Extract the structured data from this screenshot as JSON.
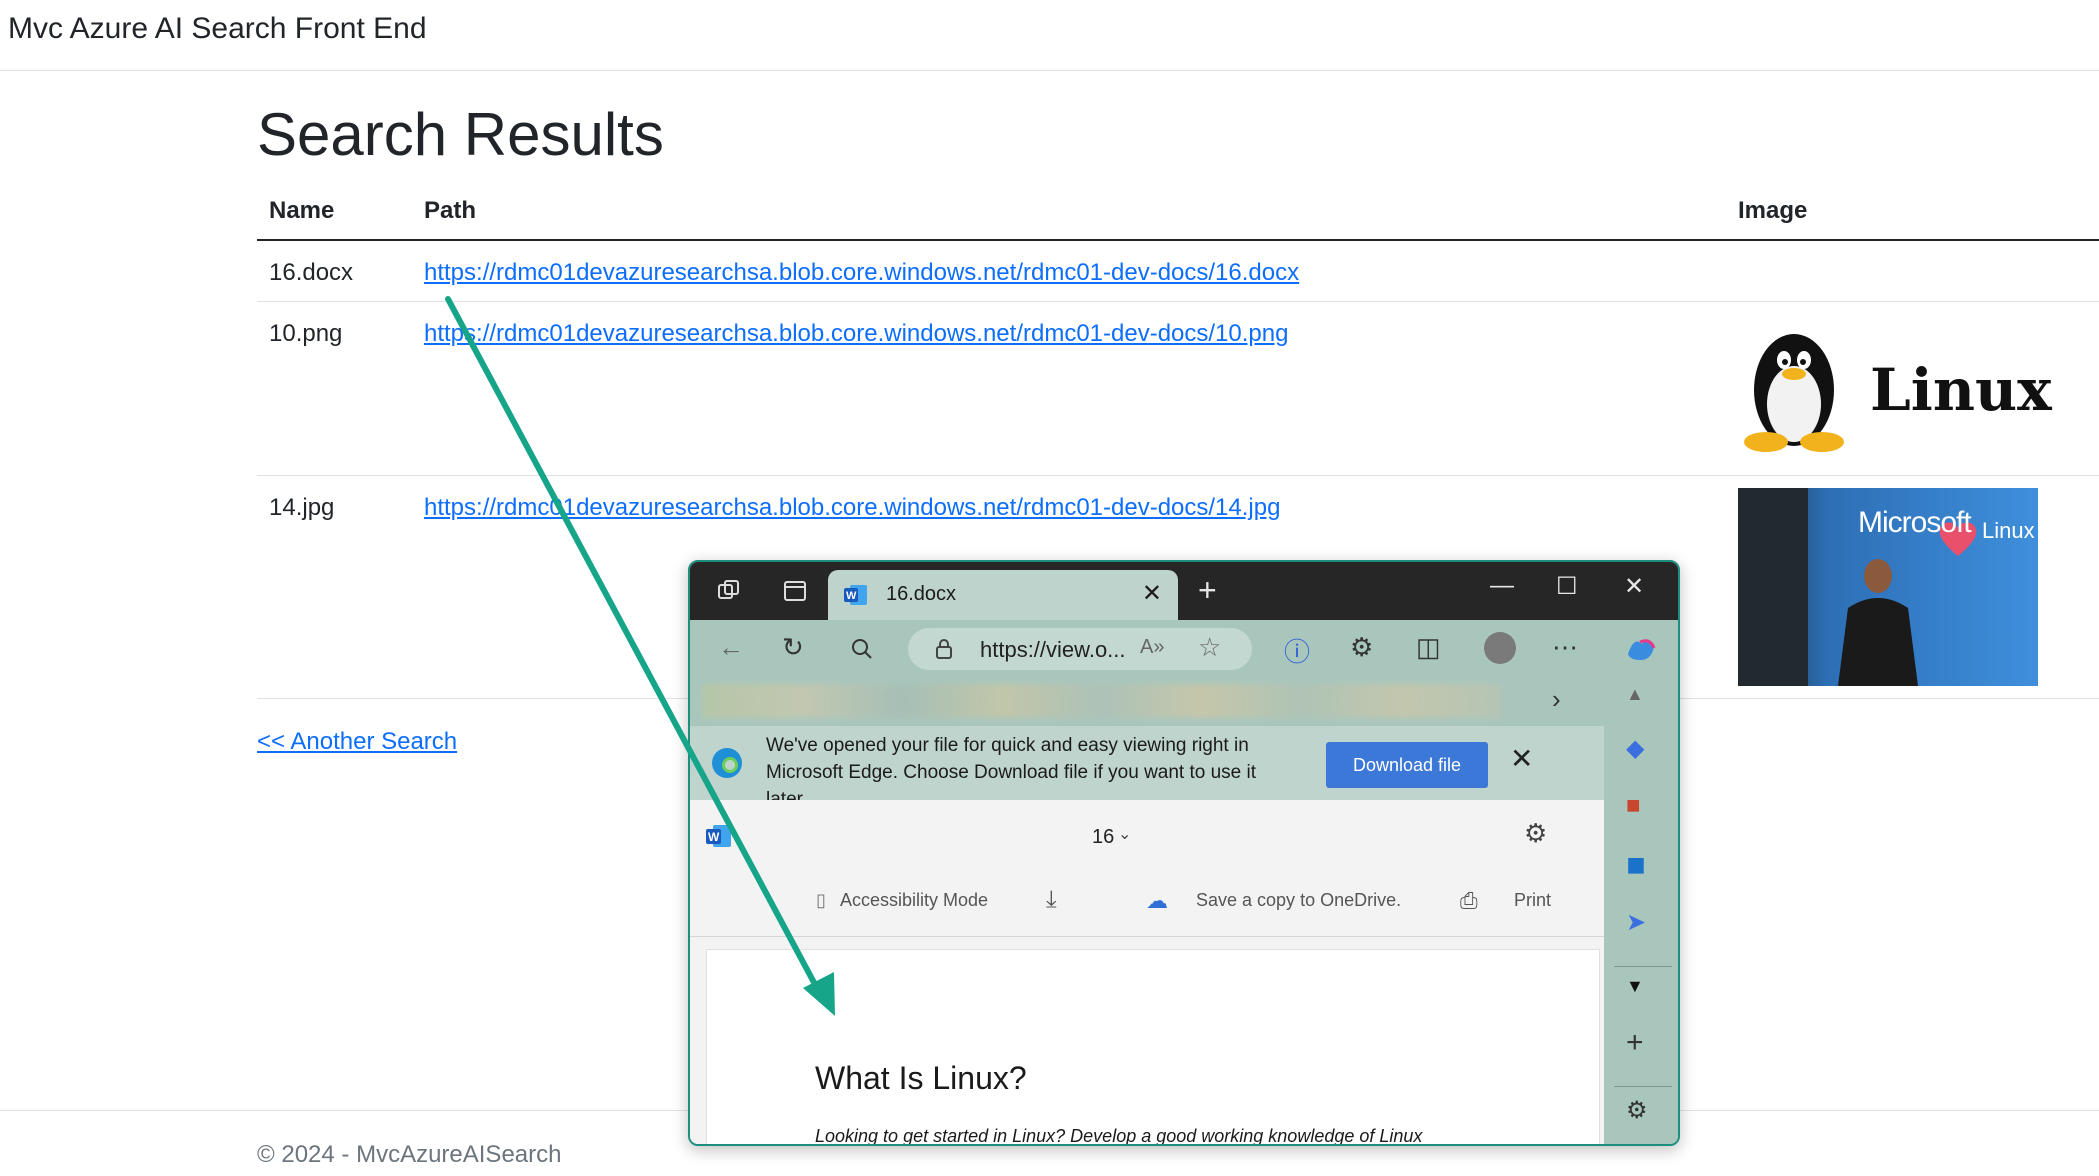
{
  "app": {
    "brand": "Mvc Azure AI Search Front End"
  },
  "page": {
    "title": "Search Results"
  },
  "table": {
    "headers": {
      "name": "Name",
      "path": "Path",
      "image": "Image"
    },
    "rows": [
      {
        "name": "16.docx",
        "path": "https://rdmc01devazuresearchsa.blob.core.windows.net/rdmc01-dev-docs/16.docx"
      },
      {
        "name": "10.png",
        "path": "https://rdmc01devazuresearchsa.blob.core.windows.net/rdmc01-dev-docs/10.png"
      },
      {
        "name": "14.jpg",
        "path": "https://rdmc01devazuresearchsa.blob.core.windows.net/rdmc01-dev-docs/14.jpg"
      }
    ]
  },
  "images": {
    "linux_logo_text": "Linux",
    "ms_banner_text_1": "Microsoft",
    "ms_banner_text_2": "Linux"
  },
  "another_search": "<< Another Search",
  "footer": "© 2024 - MvcAzureAISearch",
  "edge": {
    "tab_title": "16.docx",
    "address": "https://view.o...",
    "infobar_text": "We've opened your file for quick and easy viewing right in Microsoft Edge. Choose Download file if you want to use it later.",
    "download_button": "Download file",
    "word": {
      "page_number": "16",
      "accessibility_mode": "Accessibility Mode",
      "save_onedrive": "Save a copy to OneDrive.",
      "print": "Print",
      "doc_title": "What Is Linux?",
      "doc_subtitle": "Looking to get started in Linux? Develop a good working knowledge of Linux"
    }
  },
  "colors": {
    "link": "#0d6efd",
    "arrow": "#17a589",
    "edge_accent": "#a9c6bd"
  }
}
